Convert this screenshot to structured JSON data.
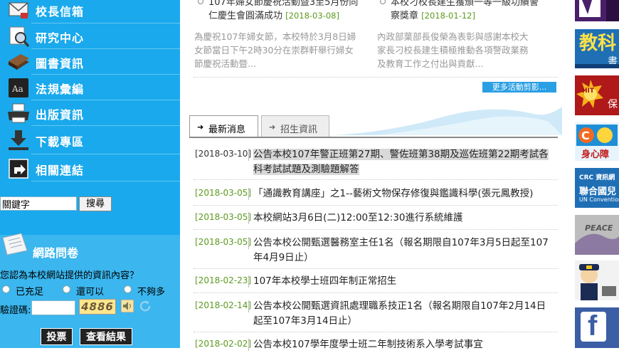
{
  "sidebar": {
    "menu": [
      {
        "label": "校長信箱",
        "icon": "mailbox-icon"
      },
      {
        "label": "研究中心",
        "icon": "magnifier-icon"
      },
      {
        "label": "圖書資訊",
        "icon": "books-icon"
      },
      {
        "label": "法規彙編",
        "icon": "dictionary-icon"
      },
      {
        "label": "出版資訊",
        "icon": "printer-icon"
      },
      {
        "label": "下載專區",
        "icon": "download-icon"
      },
      {
        "label": "相關連結",
        "icon": "link-arrow-icon"
      }
    ],
    "search": {
      "value": "關鍵字",
      "button": "搜尋"
    }
  },
  "poll": {
    "title": "網路問卷",
    "question": "您認為本校網站提供的資訊內容？",
    "options": [
      "已充足",
      "還可以",
      "不夠多"
    ],
    "captcha_label": "驗證碼:",
    "captcha_code": "4886",
    "vote_button": "投票",
    "results_button": "查看結果"
  },
  "activities": [
    {
      "title_line1": "107年婦女節慶祝活動暨3至5月份同",
      "title_line2": "仁慶生會圓滿成功",
      "date": "[2018-03-08]",
      "desc_line1": "為慶祝107年婦女節，本校特於3月8日婦",
      "desc_line2": "女節當日下午2時30分在崇群軒舉行婦女",
      "desc_line3": "節慶祝活動暨..."
    },
    {
      "title_line1": "本校刁校長建生獲頒一等一級功績警",
      "title_line2": "察獎章",
      "date": "[2018-01-12]",
      "desc_line1": "內政部葉部長俊榮為表彰與感謝本校大",
      "desc_line2": "家長刁校長建生積極推動各項警政業務",
      "desc_line3": "及教育工作之付出與貢獻..."
    }
  ],
  "more_activities": "更多活動剪影...",
  "tabs": {
    "latest": "最新消息",
    "admissions": "招生資訊"
  },
  "news": [
    {
      "date": "[2018-03-10]",
      "line1": "公告本校107年警正班第27期、警佐班第38期及巡佐班第22期考試各",
      "line2": "科考試試題及測驗題解答"
    },
    {
      "date": "[2018-03-05]",
      "line1": "「通識教育講座」之1--藝術文物保存修復與鑑識科學(張元鳳教授)",
      "line2": ""
    },
    {
      "date": "[2018-03-05]",
      "line1": "本校網站3月6日(二)12:00至12:30進行系統維護",
      "line2": ""
    },
    {
      "date": "[2018-03-05]",
      "line1": "公告本校公開甄選醫務室主任1名（報名期限自107年3月5日起至107",
      "line2": "年4月9日止）"
    },
    {
      "date": "[2018-02-23]",
      "line1": "107年本校學士班四年制正常招生",
      "line2": ""
    },
    {
      "date": "[2018-02-14]",
      "line1": "公告本校公開甄選資訊處理職系技正1名（報名期限自107年2月14日",
      "line2": "起至107年3月14日止）"
    },
    {
      "date": "[2018-02-02]",
      "line1": "公告本校107學年度學士班二年制技術系入學考試事宜",
      "line2": ""
    }
  ],
  "banners": [
    {
      "icon": "purple-banner-icon"
    },
    {
      "text": "教科",
      "sub": "書",
      "icon": "textbook-banner-icon"
    },
    {
      "text": "HIT",
      "sub": "保",
      "icon": "hit-badge-icon"
    },
    {
      "text": "身心障",
      "icon": "accessibility-banner-icon"
    },
    {
      "text": "CRC 資訊網",
      "sub": "聯合國兒",
      "small": "UN Convention",
      "icon": "crc-banner-icon"
    },
    {
      "text": "PEACE",
      "icon": "peace-banner-icon"
    },
    {
      "icon": "police-figure-icon"
    },
    {
      "text": "f",
      "icon": "facebook-icon"
    }
  ]
}
